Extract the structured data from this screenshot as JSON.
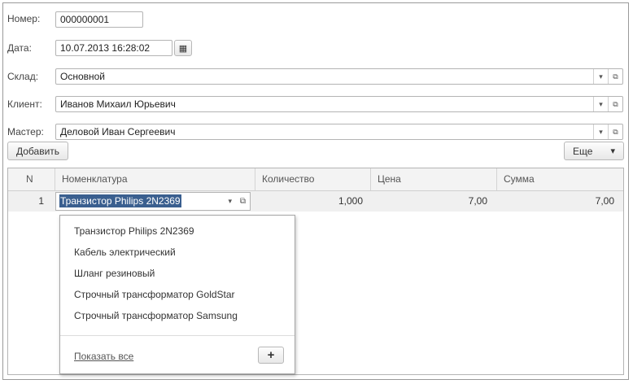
{
  "form": {
    "number_label": "Номер:",
    "number_value": "000000001",
    "date_label": "Дата:",
    "date_value": "10.07.2013 16:28:02",
    "warehouse_label": "Склад:",
    "warehouse_value": "Основной",
    "client_label": "Клиент:",
    "client_value": "Иванов Михаил Юрьевич",
    "master_label": "Мастер:",
    "master_value": "Деловой Иван Сергеевич"
  },
  "toolbar": {
    "add_label": "Добавить",
    "more_label": "Еще"
  },
  "table": {
    "columns": [
      "N",
      "Номенклатура",
      "Количество",
      "Цена",
      "Сумма"
    ],
    "rows": [
      {
        "n": "1",
        "item": "Транзистор Philips 2N2369",
        "qty": "1,000",
        "price": "7,00",
        "sum": "7,00"
      }
    ]
  },
  "dropdown": {
    "items": [
      "Транзистор Philips 2N2369",
      "Кабель электрический",
      "Шланг резиновый",
      "Строчный трансформатор GoldStar",
      "Строчный трансформатор Samsung"
    ],
    "show_all_label": "Показать все",
    "add_symbol": "+"
  },
  "icons": {
    "dropdown_arrow": "▾",
    "open_form": "⧉",
    "calendar": "▦"
  }
}
